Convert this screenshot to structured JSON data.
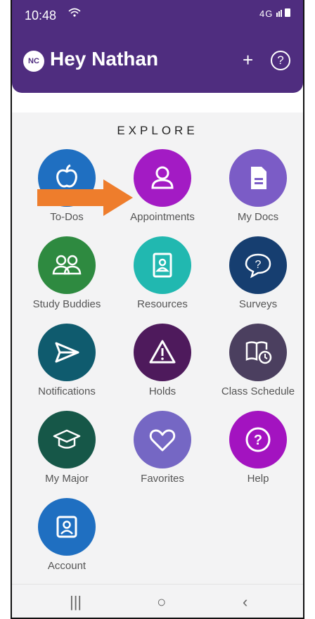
{
  "status": {
    "time": "10:48",
    "signal": "4G"
  },
  "header": {
    "avatar_initials": "NC",
    "greeting": "Hey Nathan",
    "add_label": "+",
    "help_label": "?"
  },
  "explore": {
    "title": "EXPLORE",
    "items": [
      {
        "label": "To-Dos",
        "color": "#1f6fc1",
        "icon": "apple-icon"
      },
      {
        "label": "Appointments",
        "color": "#a31bc4",
        "icon": "person-icon"
      },
      {
        "label": "My Docs",
        "color": "#7b5cc6",
        "icon": "document-icon"
      },
      {
        "label": "Study Buddies",
        "color": "#2e8a40",
        "icon": "people-icon"
      },
      {
        "label": "Resources",
        "color": "#21b8b0",
        "icon": "contact-card-icon"
      },
      {
        "label": "Surveys",
        "color": "#163e70",
        "icon": "speech-question-icon"
      },
      {
        "label": "Notifications",
        "color": "#0f5b6e",
        "icon": "send-icon"
      },
      {
        "label": "Holds",
        "color": "#4e1a5c",
        "icon": "warning-icon"
      },
      {
        "label": "Class Schedule",
        "color": "#4b3f5f",
        "icon": "book-clock-icon"
      },
      {
        "label": "My Major",
        "color": "#165748",
        "icon": "graduation-cap-icon"
      },
      {
        "label": "Favorites",
        "color": "#7567c4",
        "icon": "heart-icon"
      },
      {
        "label": "Help",
        "color": "#a313c0",
        "icon": "question-icon"
      },
      {
        "label": "Account",
        "color": "#1f6fc1",
        "icon": "account-icon"
      }
    ]
  },
  "annotation": {
    "arrow_color": "#ee7d2c"
  },
  "navbar": {
    "recents": "|||",
    "home": "○",
    "back": "‹"
  }
}
